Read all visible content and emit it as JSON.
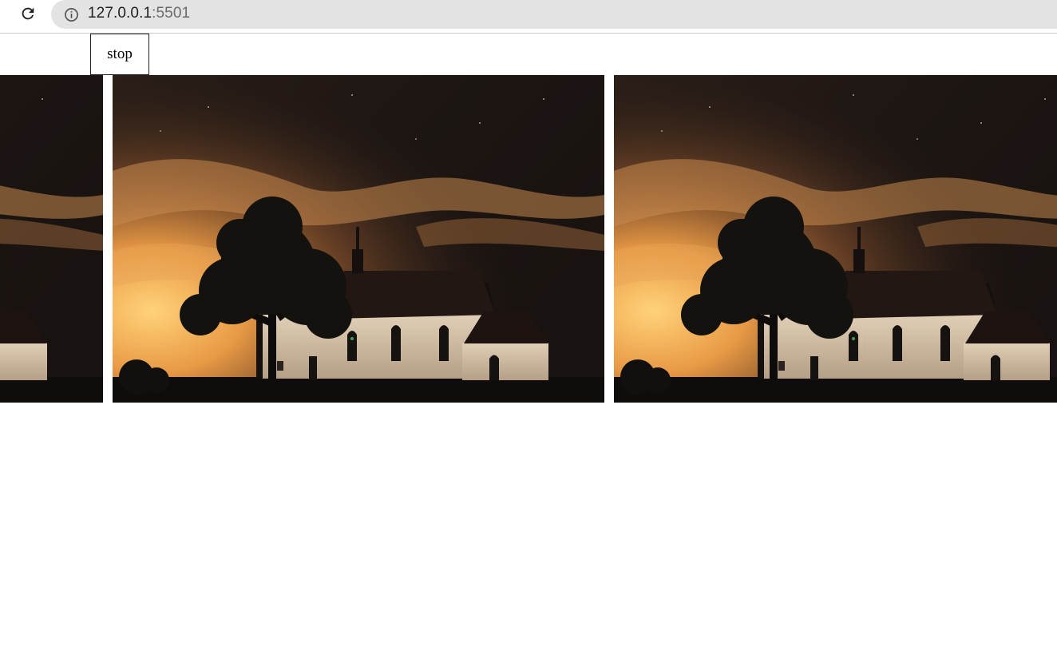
{
  "browser": {
    "url_host": "127.0.0.1",
    "url_port": ":5501",
    "reload_icon": "reload-icon",
    "info_icon": "info-icon"
  },
  "page": {
    "stop_label": "stop"
  },
  "carousel": {
    "slides": [
      {
        "image": "church-at-night-photo"
      },
      {
        "image": "church-at-night-photo"
      },
      {
        "image": "church-at-night-photo"
      }
    ]
  },
  "colors": {
    "sky_dark": "#1c1512",
    "glow": "#f2a64a",
    "wall": "#d8c7b0",
    "roof": "#1a1210"
  }
}
